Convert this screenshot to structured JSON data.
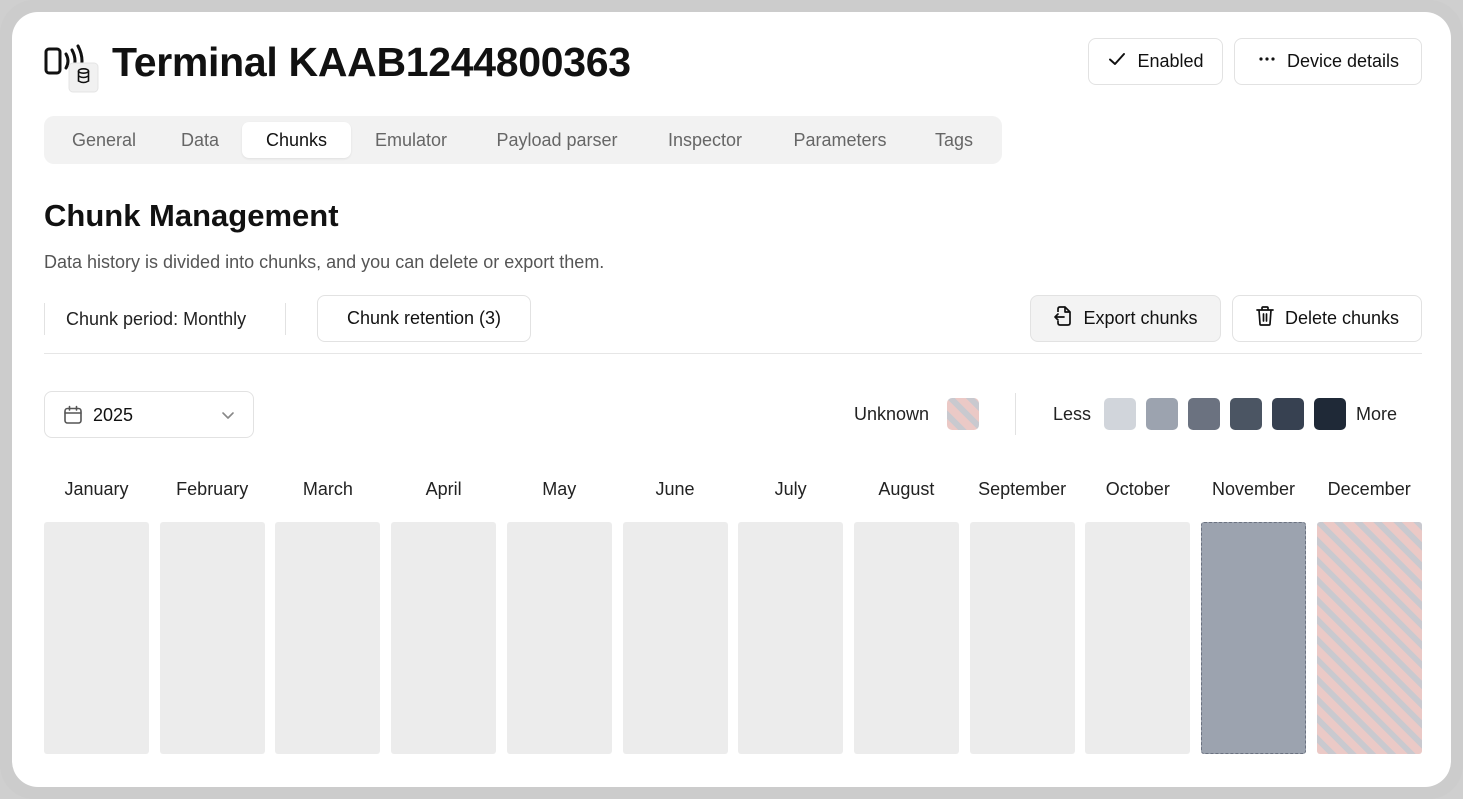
{
  "header": {
    "title": "Terminal KAAB1244800363",
    "device_icon": "terminal-database-icon",
    "enabled_label": "Enabled",
    "enabled_icon": "check-icon",
    "details_label": "Device details",
    "details_icon": "more-horizontal-icon"
  },
  "tabs": [
    {
      "label": "General",
      "active": false
    },
    {
      "label": "Data",
      "active": false
    },
    {
      "label": "Chunks",
      "active": true
    },
    {
      "label": "Emulator",
      "active": false
    },
    {
      "label": "Payload parser",
      "active": false
    },
    {
      "label": "Inspector",
      "active": false
    },
    {
      "label": "Parameters",
      "active": false
    },
    {
      "label": "Tags",
      "active": false
    }
  ],
  "section": {
    "title": "Chunk Management",
    "description": "Data history is divided into chunks, and you can delete or export them."
  },
  "toolbar": {
    "period_text": "Chunk period: Monthly",
    "retention_label": "Chunk retention (3)",
    "export_label": "Export chunks",
    "export_icon": "file-export-icon",
    "delete_label": "Delete chunks",
    "delete_icon": "trash-icon"
  },
  "year_select": {
    "value": "2025",
    "icon": "calendar-icon"
  },
  "legend": {
    "unknown_label": "Unknown",
    "less_label": "Less",
    "more_label": "More",
    "scale_colors": [
      "#d1d5db",
      "#9ca3af",
      "#6b7280",
      "#4b5563",
      "#374151",
      "#1f2937"
    ],
    "unknown_colors": [
      "#ebc9c6",
      "#c9c9cf"
    ]
  },
  "months": [
    {
      "label": "January",
      "status": "empty"
    },
    {
      "label": "February",
      "status": "empty"
    },
    {
      "label": "March",
      "status": "empty"
    },
    {
      "label": "April",
      "status": "empty"
    },
    {
      "label": "May",
      "status": "empty"
    },
    {
      "label": "June",
      "status": "empty"
    },
    {
      "label": "July",
      "status": "empty"
    },
    {
      "label": "August",
      "status": "empty"
    },
    {
      "label": "September",
      "status": "empty"
    },
    {
      "label": "October",
      "status": "empty"
    },
    {
      "label": "November",
      "status": "data",
      "level": 2,
      "color": "#9ca3af"
    },
    {
      "label": "December",
      "status": "unknown"
    }
  ],
  "colors": {
    "empty_cell": "#ececec",
    "border": "#e2e2e2",
    "tab_bg": "#f2f2f2"
  }
}
